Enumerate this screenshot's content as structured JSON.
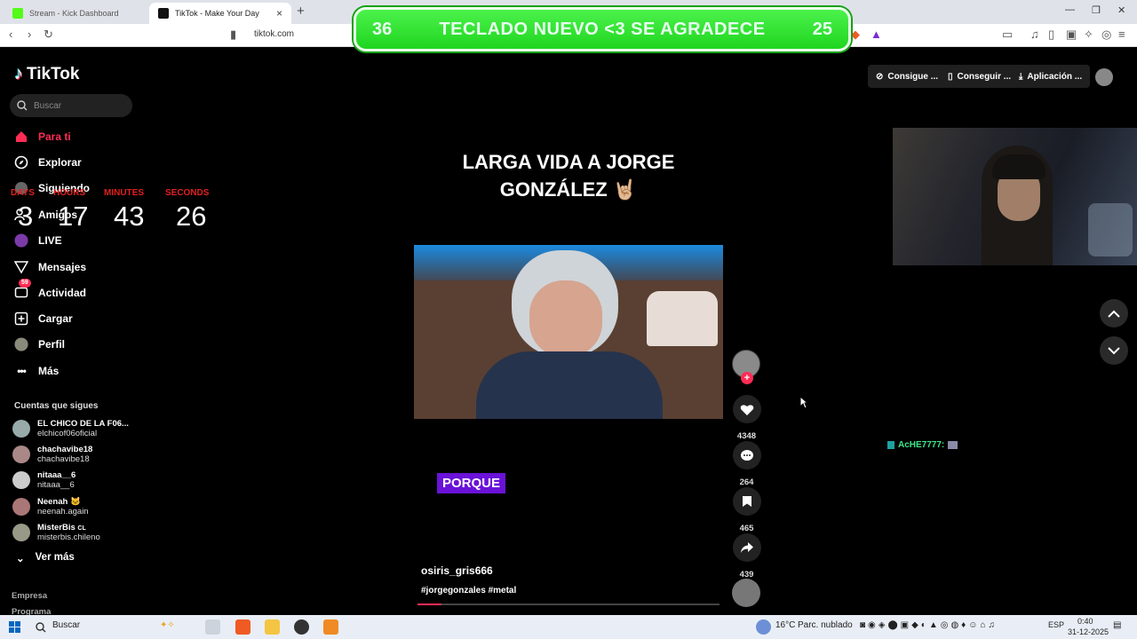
{
  "browser": {
    "tabs": [
      {
        "title": "Stream - Kick Dashboard"
      },
      {
        "title": "TikTok - Make Your Day"
      }
    ],
    "url": "tiktok.com"
  },
  "overlay": {
    "banner_left": "36",
    "banner_text": "TECLADO NUEVO <3 SE AGRADECE",
    "banner_right": "25",
    "timer": {
      "labels": [
        "DAYS",
        "HOURS",
        "MINUTES",
        "SECONDS"
      ],
      "values": [
        "3",
        "17",
        "43",
        "26"
      ]
    },
    "chat": {
      "user": "AcHE7777:"
    }
  },
  "tiktok": {
    "logo": "TikTok",
    "search_placeholder": "Buscar",
    "nav": [
      {
        "label": "Para ti",
        "icon": "home-icon"
      },
      {
        "label": "Explorar",
        "icon": "compass-icon"
      },
      {
        "label": "Siguiendo",
        "icon": "following-icon"
      },
      {
        "label": "Amigos",
        "icon": "friends-icon"
      },
      {
        "label": "LIVE",
        "icon": "live-icon"
      },
      {
        "label": "Mensajes",
        "icon": "send-icon"
      },
      {
        "label": "Actividad",
        "icon": "inbox-icon",
        "badge": "59"
      },
      {
        "label": "Cargar",
        "icon": "upload-icon"
      },
      {
        "label": "Perfil",
        "icon": "profile-icon"
      },
      {
        "label": "Más",
        "icon": "more-icon"
      }
    ],
    "following_title": "Cuentas que sigues",
    "following": [
      {
        "name": "EL CHICO DE LA F06...",
        "handle": "elchicof06oficial"
      },
      {
        "name": "chachavibe18",
        "handle": "chachavibe18"
      },
      {
        "name": "nitaaa__6",
        "handle": "nitaaa__6"
      },
      {
        "name": "Neenah",
        "handle": "neenah.again"
      },
      {
        "name": "MisterBis",
        "handle": "misterbis.chileno"
      }
    ],
    "see_more": "Ver más",
    "footer": [
      "Empresa",
      "Programa"
    ],
    "top_buttons": [
      "Consigue ...",
      "Conseguir ...",
      "Aplicación ..."
    ],
    "video": {
      "caption_line1": "LARGA VIDA A JORGE",
      "caption_line2": "GONZÁLEZ 🤘🏼",
      "subtitle": "PORQUE",
      "username": "osiris_gris666",
      "hashtags": "#jorgegonzales #metal",
      "progress": 0.08
    },
    "actions": {
      "likes": "4348",
      "comments": "264",
      "saves": "465",
      "shares": "439"
    }
  },
  "taskbar": {
    "search": "Buscar",
    "weather": "16°C",
    "weather_desc": "Parc. nublado",
    "lang": "ESP",
    "time": "0:40",
    "date": "31-12-2025"
  }
}
